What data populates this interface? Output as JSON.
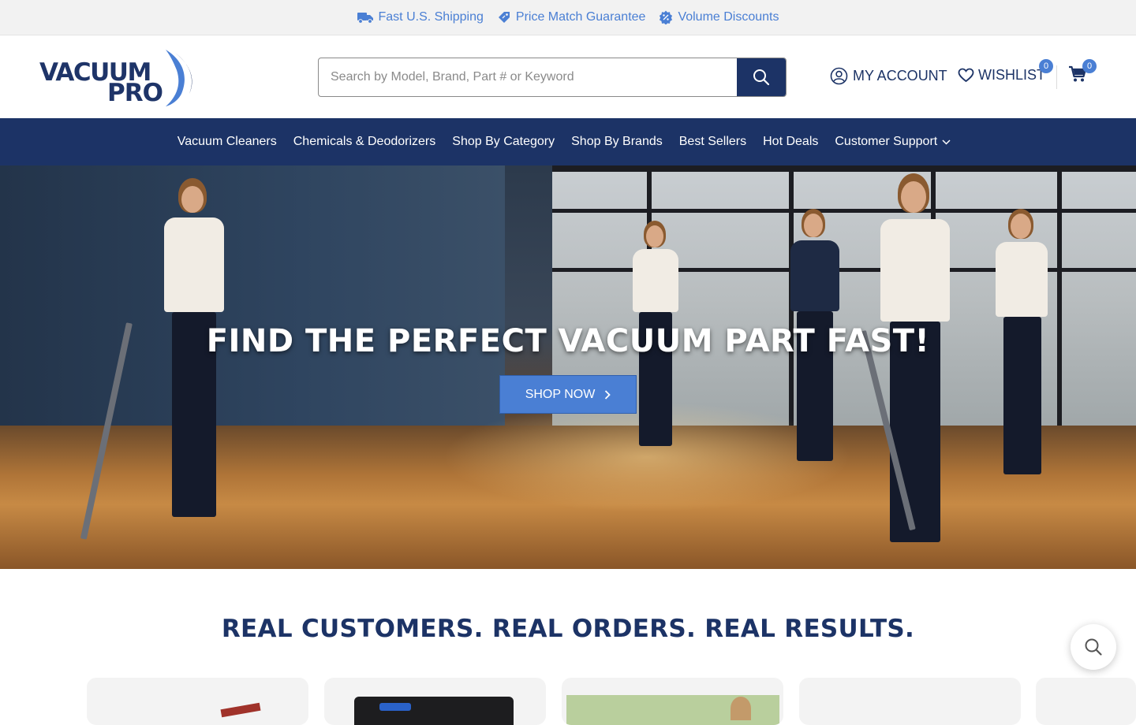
{
  "promo": {
    "items": [
      {
        "label": "Fast U.S. Shipping",
        "icon": "truck-icon"
      },
      {
        "label": "Price Match Guarantee",
        "icon": "tag-icon"
      },
      {
        "label": "Volume Discounts",
        "icon": "discount-badge-icon"
      }
    ]
  },
  "header": {
    "logo_line1": "VACUUM",
    "logo_line2": "PRO",
    "search_placeholder": "Search by Model, Brand, Part # or Keyword",
    "account_label": "MY ACCOUNT",
    "wishlist_label": "WISHLIST",
    "wishlist_count": "0",
    "cart_count": "0"
  },
  "nav": {
    "items": [
      {
        "label": "Vacuum Cleaners"
      },
      {
        "label": "Chemicals & Deodorizers"
      },
      {
        "label": "Shop By Category"
      },
      {
        "label": "Shop By Brands"
      },
      {
        "label": "Best Sellers"
      },
      {
        "label": "Hot Deals"
      },
      {
        "label": "Customer Support"
      }
    ]
  },
  "hero": {
    "title": "FIND THE PERFECT VACUUM PART FAST!",
    "cta_label": "SHOP NOW"
  },
  "section": {
    "title": "REAL CUSTOMERS. REAL ORDERS. REAL RESULTS."
  },
  "colors": {
    "brand_navy": "#1c3366",
    "accent_blue": "#4a7fd4",
    "promo_bg": "#f2f2f2"
  }
}
